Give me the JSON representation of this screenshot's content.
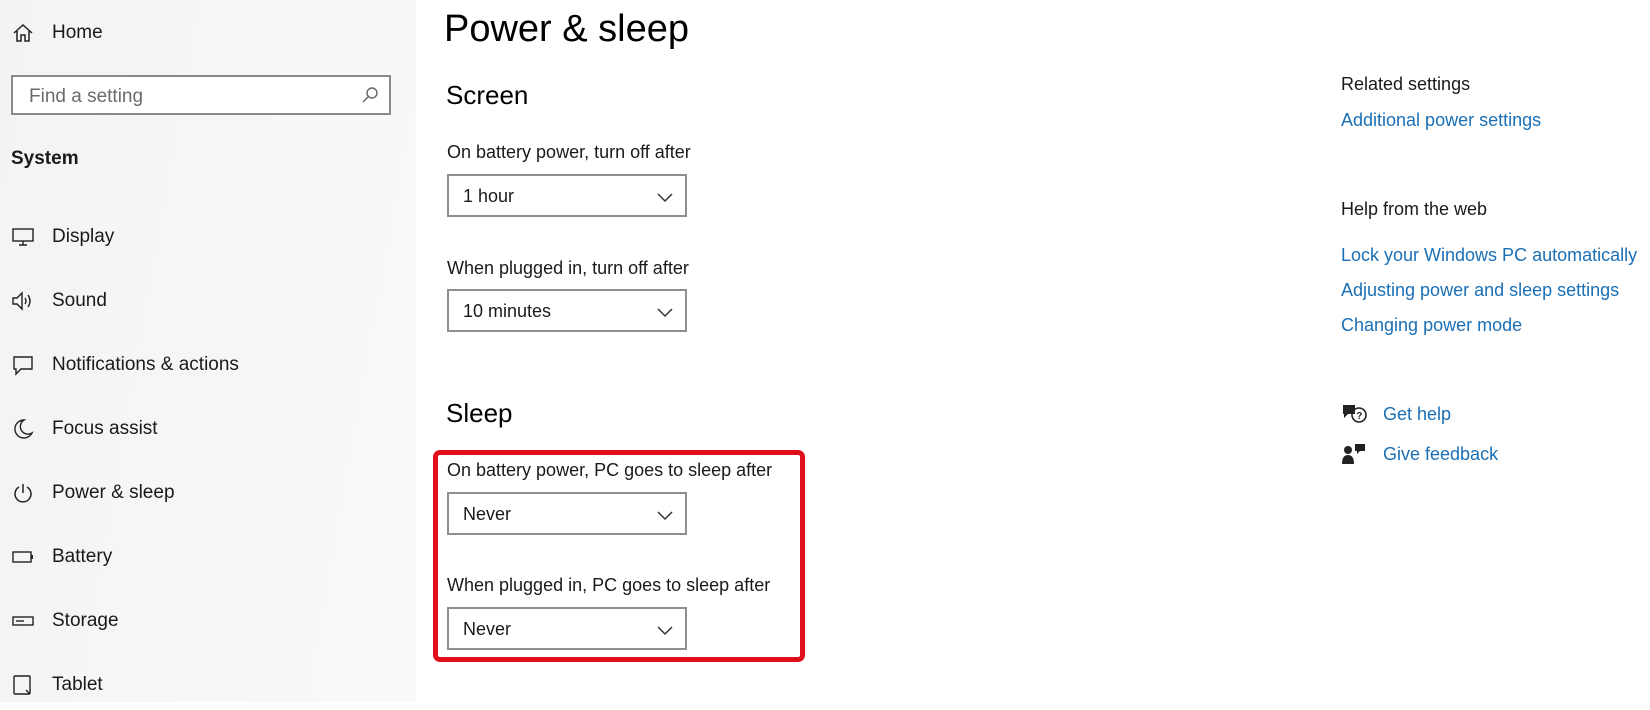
{
  "sidebar": {
    "home_label": "Home",
    "search_placeholder": "Find a setting",
    "section_label": "System",
    "items": [
      {
        "label": "Display",
        "icon": "monitor-icon"
      },
      {
        "label": "Sound",
        "icon": "speaker-icon"
      },
      {
        "label": "Notifications & actions",
        "icon": "notification-icon"
      },
      {
        "label": "Focus assist",
        "icon": "moon-icon"
      },
      {
        "label": "Power & sleep",
        "icon": "power-icon"
      },
      {
        "label": "Battery",
        "icon": "battery-icon"
      },
      {
        "label": "Storage",
        "icon": "storage-icon"
      },
      {
        "label": "Tablet",
        "icon": "tablet-icon"
      }
    ]
  },
  "main": {
    "title": "Power & sleep",
    "screen": {
      "heading": "Screen",
      "battery_label": "On battery power, turn off after",
      "battery_value": "1 hour",
      "plugged_label": "When plugged in, turn off after",
      "plugged_value": "10 minutes"
    },
    "sleep": {
      "heading": "Sleep",
      "battery_label": "On battery power, PC goes to sleep after",
      "battery_value": "Never",
      "plugged_label": "When plugged in, PC goes to sleep after",
      "plugged_value": "Never"
    }
  },
  "right": {
    "related_heading": "Related settings",
    "related_link": "Additional power settings",
    "help_heading": "Help from the web",
    "help_links": [
      "Lock your Windows PC automatically",
      "Adjusting power and sleep settings",
      "Changing power mode"
    ],
    "get_help": "Get help",
    "give_feedback": "Give feedback"
  },
  "colors": {
    "link": "#1a6fb5",
    "highlight": "#e0101a",
    "sidebar_bg": "#f3f3f3"
  }
}
